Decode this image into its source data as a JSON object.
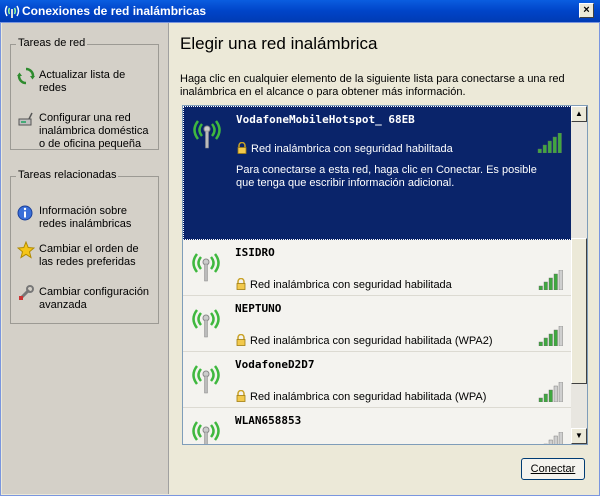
{
  "window": {
    "title": "Conexiones de red inalámbricas",
    "close_label": "×"
  },
  "sidebar": {
    "network_tasks": {
      "label": "Tareas de red",
      "items": [
        {
          "icon": "refresh-icon",
          "label": "Actualizar lista de redes"
        },
        {
          "icon": "network-setup-icon",
          "label": "Configurar una red inalámbrica doméstica o de oficina pequeña"
        }
      ]
    },
    "related_tasks": {
      "label": "Tareas relacionadas",
      "items": [
        {
          "icon": "info-icon",
          "label": "Información sobre redes inalámbricas"
        },
        {
          "icon": "star-icon",
          "label": "Cambiar el orden de las redes preferidas"
        },
        {
          "icon": "wrench-icon",
          "label": "Cambiar configuración avanzada"
        }
      ]
    }
  },
  "main": {
    "heading": "Elegir una red inalámbrica",
    "description": "Haga clic en cualquier elemento de la siguiente lista para conectarse a una red inalámbrica en el alcance o para obtener más información.",
    "networks": [
      {
        "ssid": "VodafoneMobileHotspot_ 68EB",
        "security": "Red inalámbrica con seguridad habilitada",
        "signal": 5,
        "selected": true,
        "info": "Para conectarse a esta red, haga clic en Conectar. Es posible que tenga que escribir información adicional."
      },
      {
        "ssid": "ISIDRO",
        "security": "Red inalámbrica con seguridad habilitada",
        "signal": 4
      },
      {
        "ssid": "NEPTUNO",
        "security": "Red inalámbrica con seguridad habilitada (WPA2)",
        "signal": 4
      },
      {
        "ssid": "VodafoneD2D7",
        "security": "Red inalámbrica con seguridad habilitada (WPA)",
        "signal": 3
      },
      {
        "ssid": "WLAN658853",
        "security": "",
        "signal": 2
      }
    ],
    "scroll_up": "▲",
    "scroll_down": "▼",
    "connect_button": "Conectar"
  },
  "colors": {
    "titlebar": "#0054e3",
    "selection": "#0a246a",
    "signal_on": "#3fa83f",
    "signal_off": "#cfcfcf"
  }
}
